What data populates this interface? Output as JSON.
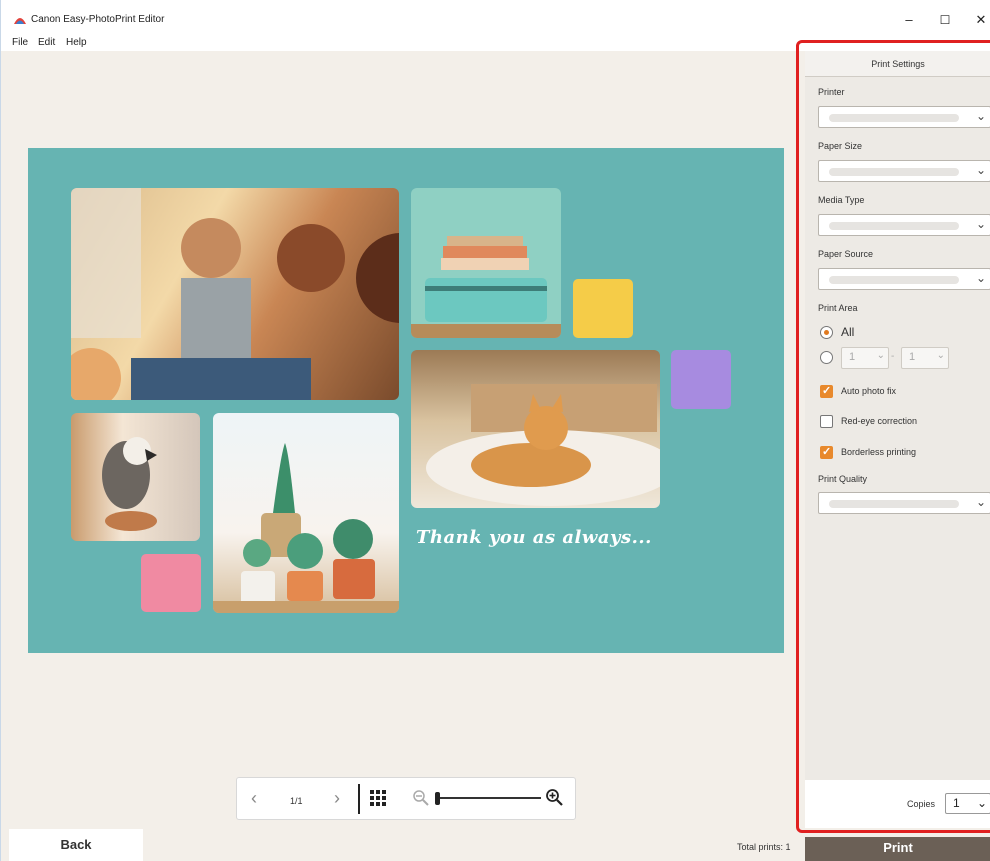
{
  "window": {
    "title": "Canon Easy-PhotoPrint Editor",
    "controls": [
      "–",
      "☐",
      "✕"
    ]
  },
  "menu": [
    "File",
    "Edit",
    "Help"
  ],
  "canvas": {
    "message": "Thank you as always...",
    "page_color": "#66b4b2",
    "accent_squares": [
      "#f5cc48",
      "#a78be0",
      "#f08aa2"
    ]
  },
  "navigator": {
    "prev": "‹",
    "page": "1/1",
    "next": "›",
    "zoom_level": 0.0
  },
  "footer": {
    "back_label": "Back",
    "total_prints": "Total prints: 1",
    "print_label": "Print"
  },
  "panel": {
    "title": "Print Settings",
    "printer_label": "Printer",
    "paper_size_label": "Paper Size",
    "media_type_label": "Media Type",
    "paper_source_label": "Paper Source",
    "print_area_label": "Print Area",
    "print_area_all": "All",
    "range_from": "1",
    "range_to": "1",
    "auto_photo_fix": "Auto photo fix",
    "auto_photo_fix_checked": true,
    "red_eye": "Red-eye correction",
    "red_eye_checked": false,
    "borderless": "Borderless printing",
    "borderless_checked": true,
    "print_quality_label": "Print Quality",
    "copies_label": "Copies",
    "copies_value": "1"
  }
}
